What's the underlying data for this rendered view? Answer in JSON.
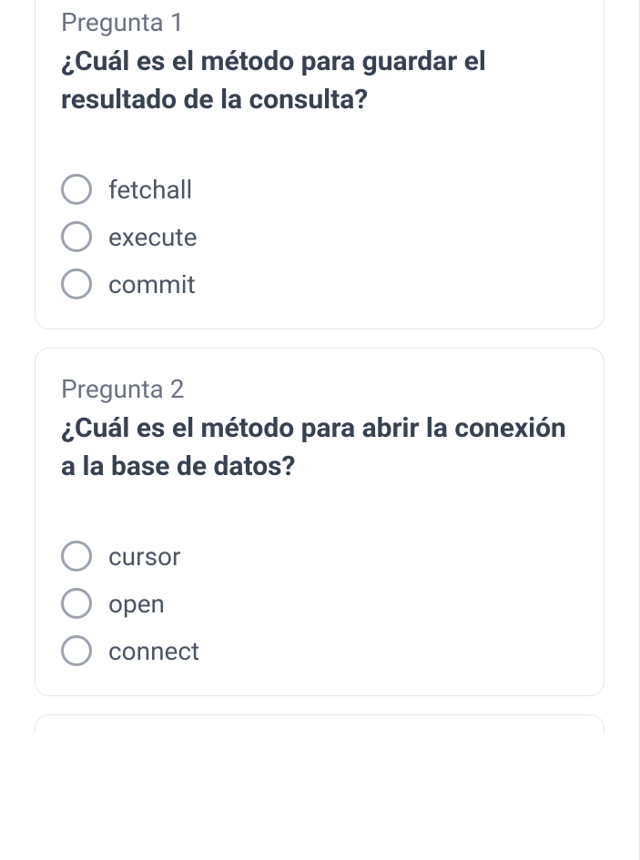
{
  "questions": [
    {
      "number": "Pregunta 1",
      "title": "¿Cuál es el método para guardar el resultado de la consulta?",
      "options": [
        {
          "label": "fetchall"
        },
        {
          "label": "execute"
        },
        {
          "label": "commit"
        }
      ]
    },
    {
      "number": "Pregunta 2",
      "title": "¿Cuál es el método para abrir la conexión a la base de datos?",
      "options": [
        {
          "label": "cursor"
        },
        {
          "label": "open"
        },
        {
          "label": "connect"
        }
      ]
    }
  ]
}
